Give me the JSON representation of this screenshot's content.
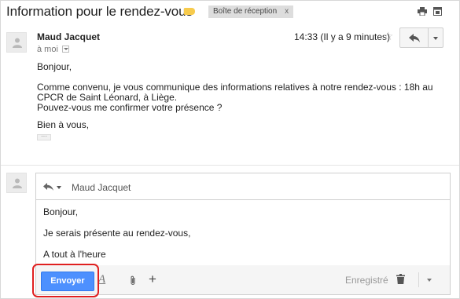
{
  "thread": {
    "subject": "Information pour le rendez-vous",
    "label_color": "#f7cb4d",
    "inbox_label": "Boîte de réception",
    "inbox_remove": "x",
    "print_icon": "print-icon",
    "new_window_icon": "new-window-icon"
  },
  "message": {
    "sender": "Maud Jacquet",
    "recipient_label": "à moi",
    "time": "14:33 (Il y a 9 minutes)",
    "star_glyph": "☆",
    "greeting": "Bonjour,",
    "paragraph": "Comme convenu, je vous communique des informations relatives à notre rendez-vous : 18h au CPCR de Saint Léonard, à Liège.",
    "question": "Pouvez-vous me confirmer votre présence ?",
    "closing": "Bien à vous,",
    "trimmed_content": "···"
  },
  "reply": {
    "recipient": "Maud Jacquet",
    "lines": [
      "Bonjour,",
      "Je serais présente au rendez-vous,",
      "A tout à l'heure"
    ],
    "send_label": "Envoyer",
    "format_glyph": "A",
    "plus_glyph": "+",
    "saved_label": "Enregistré"
  },
  "colors": {
    "send_button": "#4d90fe",
    "highlight": "#e02020"
  }
}
